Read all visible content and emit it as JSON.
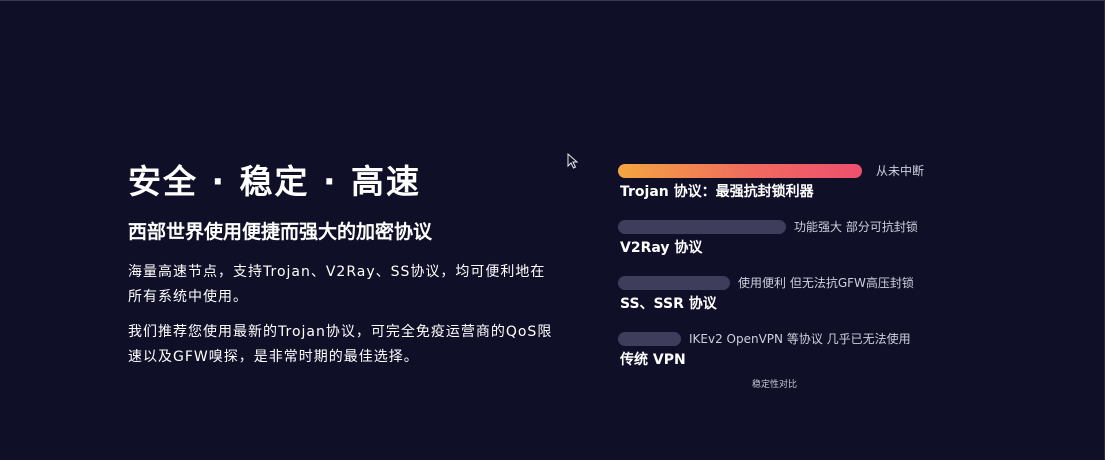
{
  "hero": {
    "headline": "安全 · 稳定 · 高速",
    "subheadline": "西部世界使用便捷而强大的加密协议",
    "paragraphs": [
      "海量高速节点，支持Trojan、V2Ray、SS协议，均可便利地在所有系统中使用。",
      "我们推荐您使用最新的Trojan协议，可完全免疫运营商的QoS限速以及GFW嗅探，是非常时期的最佳选择。"
    ]
  },
  "chart_data": {
    "type": "bar",
    "categories": [
      "Trojan 协议：最强抗封锁利器",
      "V2Ray 协议",
      "SS、SSR 协议",
      "传统 VPN"
    ],
    "values": [
      100,
      69,
      46,
      26
    ],
    "annotations": [
      "从未中断",
      "功能强大 部分可抗封锁",
      "使用便利 但无法抗GFW高压封锁",
      "IKEv2 OpenVPN 等协议 几乎已无法使用"
    ],
    "caption": "稳定性对比",
    "colors": {
      "highlight_start": "#f3a541",
      "highlight_end": "#ee4f6e",
      "default": "#3e3e5c"
    }
  }
}
